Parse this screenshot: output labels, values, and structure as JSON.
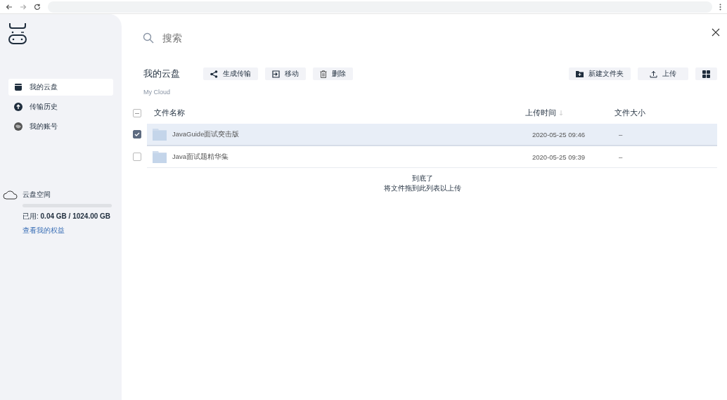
{
  "sidebar": {
    "items": [
      {
        "label": "我的云盘",
        "selected": true,
        "kind": "disk"
      },
      {
        "label": "传输历史",
        "selected": false,
        "kind": "upload"
      },
      {
        "label": "我的账号",
        "selected": false,
        "kind": "account"
      }
    ],
    "storage": {
      "title": "云盘空间",
      "used_label": "已用: ",
      "used_value": "0.04 GB / 1024.00 GB",
      "link": "查看我的权益"
    }
  },
  "search": {
    "placeholder": "搜索"
  },
  "header": {
    "title": "我的云盘",
    "subtitle": "My Cloud",
    "actions": [
      {
        "label": "生成传输",
        "kind": "share"
      },
      {
        "label": "移动",
        "kind": "move"
      },
      {
        "label": "删除",
        "kind": "delete"
      }
    ],
    "right_actions": [
      {
        "label": "新建文件夹",
        "kind": "folder"
      },
      {
        "label": "上传",
        "kind": "upload"
      }
    ]
  },
  "table": {
    "select_all_partial": true,
    "columns": [
      "文件名称",
      "上传时间",
      "文件大小"
    ],
    "rows": [
      {
        "name": "JavaGuide面试突击版",
        "time": "2020-05-25 09:46",
        "size": "–",
        "selected": true
      },
      {
        "name": "Java面试题精华集",
        "time": "2020-05-25 09:39",
        "size": "–",
        "selected": false
      }
    ]
  },
  "footer": {
    "end": "到底了",
    "hint": "将文件拖到此列表以上传"
  }
}
